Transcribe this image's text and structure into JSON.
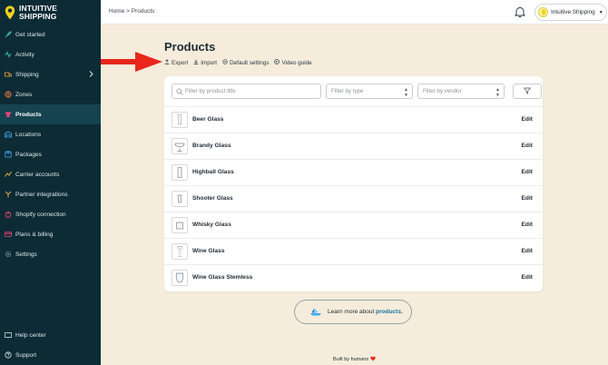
{
  "app": {
    "logo_line1": "INTUITIVE",
    "logo_line2": "SHIPPING",
    "brand_color": "#f2d21b",
    "sidebar_bg": "#0d2b35"
  },
  "sidebar": {
    "items": [
      {
        "label": "Get started",
        "icon": "rocket-icon"
      },
      {
        "label": "Activity",
        "icon": "activity-icon"
      },
      {
        "label": "Shipping",
        "icon": "shipping-icon"
      },
      {
        "label": "Zones",
        "icon": "globe-icon"
      },
      {
        "label": "Products",
        "icon": "shirt-icon",
        "active": true
      },
      {
        "label": "Locations",
        "icon": "warehouse-icon"
      },
      {
        "label": "Packages",
        "icon": "package-icon"
      },
      {
        "label": "Carrier accounts",
        "icon": "carrier-icon"
      },
      {
        "label": "Partner integrations",
        "icon": "integrations-icon"
      },
      {
        "label": "Shopify connection",
        "icon": "shopify-icon"
      },
      {
        "label": "Plans & billing",
        "icon": "billing-icon"
      },
      {
        "label": "Settings",
        "icon": "gear-icon"
      }
    ],
    "bottom": [
      {
        "label": "Help center",
        "icon": "book-icon"
      },
      {
        "label": "Support",
        "icon": "help-icon"
      }
    ]
  },
  "topbar": {
    "breadcrumb": "Home > Products",
    "user_name": "Intuitive Shipping"
  },
  "page": {
    "title": "Products",
    "actions": {
      "export": "Export",
      "import": "Import",
      "default_settings": "Default settings",
      "video_guide": "Video guide"
    }
  },
  "filters": {
    "search_placeholder": "Filter by product title",
    "type_placeholder": "Filter by type",
    "vendor_placeholder": "Filter by vendor"
  },
  "products": [
    {
      "name": "Beer Glass",
      "edit": "Edit"
    },
    {
      "name": "Brandy Glass",
      "edit": "Edit"
    },
    {
      "name": "Highball Glass",
      "edit": "Edit"
    },
    {
      "name": "Shooter Glass",
      "edit": "Edit"
    },
    {
      "name": "Whisky Glass",
      "edit": "Edit"
    },
    {
      "name": "Wine Glass",
      "edit": "Edit"
    },
    {
      "name": "Wine Glass Stemless",
      "edit": "Edit"
    }
  ],
  "learn_more": {
    "text": "Learn more about",
    "link": "products."
  },
  "footer": {
    "text": "Built by humans"
  }
}
